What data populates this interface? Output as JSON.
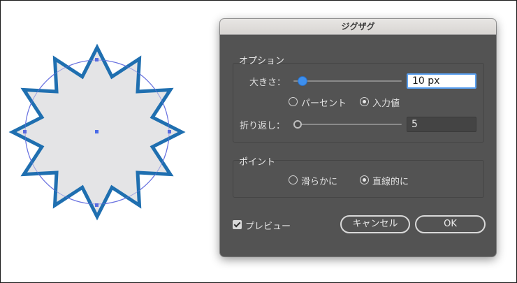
{
  "dialog": {
    "title": "ジグザグ",
    "options_group": {
      "label": "オプション",
      "size_label": "大きさ：",
      "size_value": "10 px",
      "size_slider_level": 0.05,
      "percent_label": "パーセント",
      "absolute_label": "入力値",
      "selected_mode": "absolute",
      "ridges_label": "折り返し：",
      "ridges_value": "5",
      "ridges_slider_level": 0.0
    },
    "points_group": {
      "label": "ポイント",
      "smooth_label": "滑らかに",
      "corner_label": "直線的に",
      "selected": "corner"
    },
    "preview_label": "プレビュー",
    "preview_checked": true,
    "cancel_label": "キャンセル",
    "ok_label": "OK"
  },
  "colors": {
    "dialog_bg": "#535353",
    "accent_blue": "#3d8fee",
    "star_stroke": "#1f6fb0",
    "star_fill": "#e4e4e6",
    "guide_circle": "#6a73e0"
  }
}
